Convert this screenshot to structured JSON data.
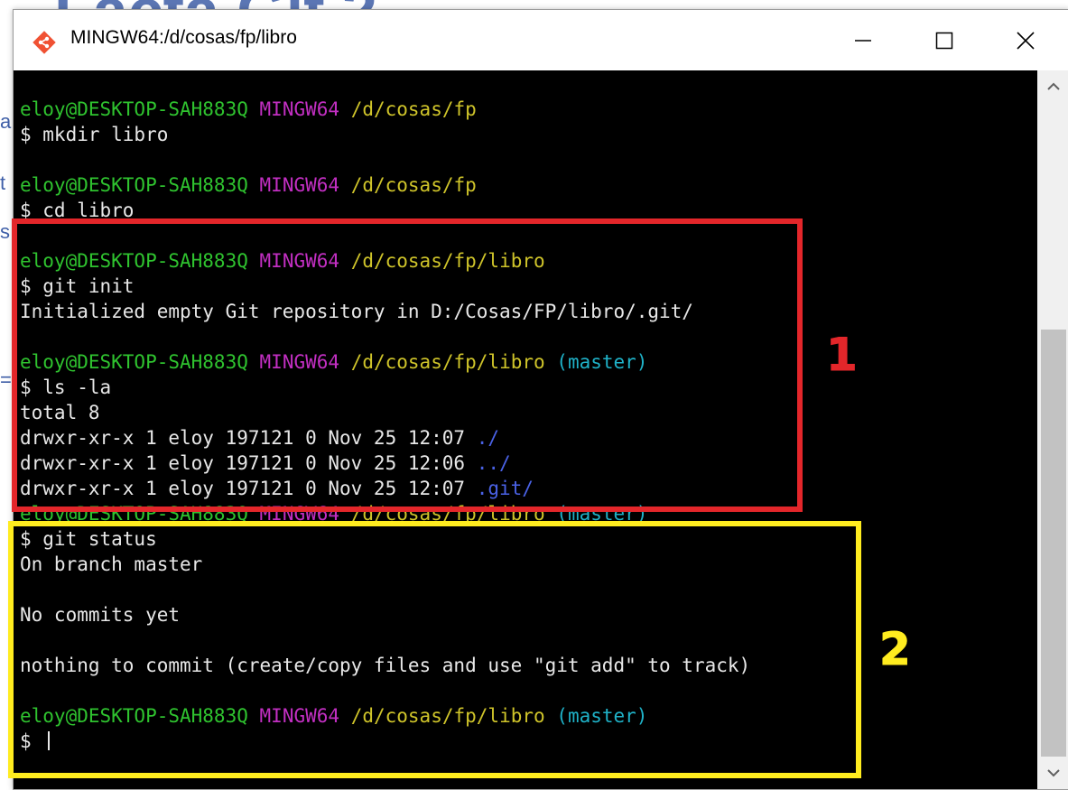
{
  "window": {
    "title": "MINGW64:/d/cosas/fp/libro",
    "controls": [
      "minimize",
      "maximize",
      "close"
    ]
  },
  "colors": {
    "user": "#2fc32f",
    "host": "#c22fc2",
    "path": "#cfc42a",
    "branch": "#1fb2c8",
    "link": "#4a62e6",
    "text": "#e8e8e8",
    "annotation_1": "#e3262a",
    "annotation_2": "#ffec1f"
  },
  "icons": {
    "app": "git-diamond-icon",
    "minimize": "minimize-icon",
    "maximize": "maximize-icon",
    "close": "close-icon",
    "scroll_up": "chevron-up-icon",
    "scroll_down": "chevron-down-icon"
  },
  "terminal": {
    "lines": [
      {
        "type": "prompt",
        "user": "eloy@DESKTOP-SAH883Q",
        "host": "MINGW64",
        "path": "/d/cosas/fp",
        "branch": ""
      },
      {
        "type": "command",
        "text": "$ mkdir libro"
      },
      {
        "type": "blank",
        "text": ""
      },
      {
        "type": "prompt",
        "user": "eloy@DESKTOP-SAH883Q",
        "host": "MINGW64",
        "path": "/d/cosas/fp",
        "branch": ""
      },
      {
        "type": "command",
        "text": "$ cd libro"
      },
      {
        "type": "blank",
        "text": ""
      },
      {
        "type": "prompt",
        "user": "eloy@DESKTOP-SAH883Q",
        "host": "MINGW64",
        "path": "/d/cosas/fp/libro",
        "branch": ""
      },
      {
        "type": "command",
        "text": "$ git init"
      },
      {
        "type": "output",
        "text": "Initialized empty Git repository in D:/Cosas/FP/libro/.git/"
      },
      {
        "type": "blank",
        "text": ""
      },
      {
        "type": "prompt",
        "user": "eloy@DESKTOP-SAH883Q",
        "host": "MINGW64",
        "path": "/d/cosas/fp/libro",
        "branch": "(master)"
      },
      {
        "type": "command",
        "text": "$ ls -la"
      },
      {
        "type": "output",
        "text": "total 8"
      },
      {
        "type": "listing",
        "text": "drwxr-xr-x 1 eloy 197121 0 Nov 25 12:07 ",
        "name": "./"
      },
      {
        "type": "listing",
        "text": "drwxr-xr-x 1 eloy 197121 0 Nov 25 12:06 ",
        "name": "../"
      },
      {
        "type": "listing",
        "text": "drwxr-xr-x 1 eloy 197121 0 Nov 25 12:07 ",
        "name": ".git/"
      },
      {
        "type": "prompt",
        "user": "eloy@DESKTOP-SAH883Q",
        "host": "MINGW64",
        "path": "/d/cosas/fp/libro",
        "branch": "(master)"
      },
      {
        "type": "command",
        "text": "$ git status"
      },
      {
        "type": "output",
        "text": "On branch master"
      },
      {
        "type": "blank",
        "text": ""
      },
      {
        "type": "output",
        "text": "No commits yet"
      },
      {
        "type": "blank",
        "text": ""
      },
      {
        "type": "output",
        "text": "nothing to commit (create/copy files and use \"git add\" to track)"
      },
      {
        "type": "blank",
        "text": ""
      },
      {
        "type": "prompt",
        "user": "eloy@DESKTOP-SAH883Q",
        "host": "MINGW64",
        "path": "/d/cosas/fp/libro",
        "branch": "(master)"
      },
      {
        "type": "input",
        "text": "$ "
      }
    ]
  },
  "annotations": {
    "label_1": "1",
    "label_2": "2"
  }
}
